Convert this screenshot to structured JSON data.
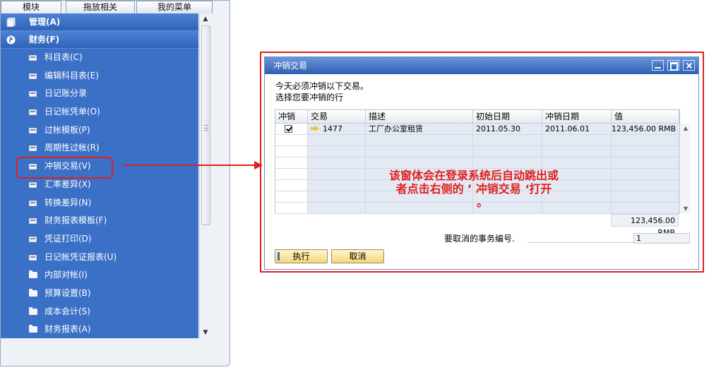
{
  "nav": {
    "tabs": [
      "模块",
      "拖放相关",
      "我的菜单"
    ],
    "groups": [
      {
        "label": "管理(A)",
        "icon": "document-stack-icon"
      },
      {
        "label": "财务(F)",
        "icon": "finance-icon"
      }
    ],
    "items": [
      {
        "label": "科目表(C)",
        "icon": "form-icon"
      },
      {
        "label": "编辑科目表(E)",
        "icon": "form-icon"
      },
      {
        "label": "日记账分录",
        "icon": "form-icon"
      },
      {
        "label": "日记帐凭单(O)",
        "icon": "form-icon"
      },
      {
        "label": "过帐模板(P)",
        "icon": "form-icon"
      },
      {
        "label": "周期性过帐(R)",
        "icon": "form-icon"
      },
      {
        "label": "冲销交易(V)",
        "icon": "form-icon"
      },
      {
        "label": "汇率差异(X)",
        "icon": "form-icon"
      },
      {
        "label": "转换差异(N)",
        "icon": "form-icon"
      },
      {
        "label": "财务报表模板(F)",
        "icon": "form-icon"
      },
      {
        "label": "凭证打印(D)",
        "icon": "form-icon"
      },
      {
        "label": "日记帐凭证报表(U)",
        "icon": "form-icon"
      },
      {
        "label": "内部对帐(I)",
        "icon": "folder-icon"
      },
      {
        "label": "预算设置(B)",
        "icon": "folder-icon"
      },
      {
        "label": "成本会计(S)",
        "icon": "folder-icon"
      },
      {
        "label": "财务报表(A)",
        "icon": "folder-icon"
      }
    ]
  },
  "dialog": {
    "title": "冲销交易",
    "line1": "今天必须冲销以下交易。",
    "line2": "选择您要冲销的行",
    "columns": [
      "冲销",
      "交易",
      "描述",
      "初始日期",
      "冲销日期",
      "值"
    ],
    "rows": [
      {
        "checked": true,
        "transaction": "1477",
        "description": "工厂办公室租赁",
        "start_date": "2011.05.30",
        "reverse_date": "2011.06.01",
        "value": "123,456.00 RMB"
      }
    ],
    "total": "123,456.00 RMB",
    "cancel_label": "要取消的事务编号.",
    "cancel_value": "1",
    "execute_button": "执行",
    "cancel_button": "取消"
  },
  "annotation": {
    "line1": "该窗体会在登录系统后自动跳出或",
    "line2": "者点击右侧的 ’ 冲销交易 ‘打开",
    "line3": "。"
  },
  "colors": {
    "nav_blue": "#3b70c7",
    "title_blue": "#2f5fb3",
    "annotation_red": "#e02020",
    "button_yellow": "#f4d77a"
  }
}
